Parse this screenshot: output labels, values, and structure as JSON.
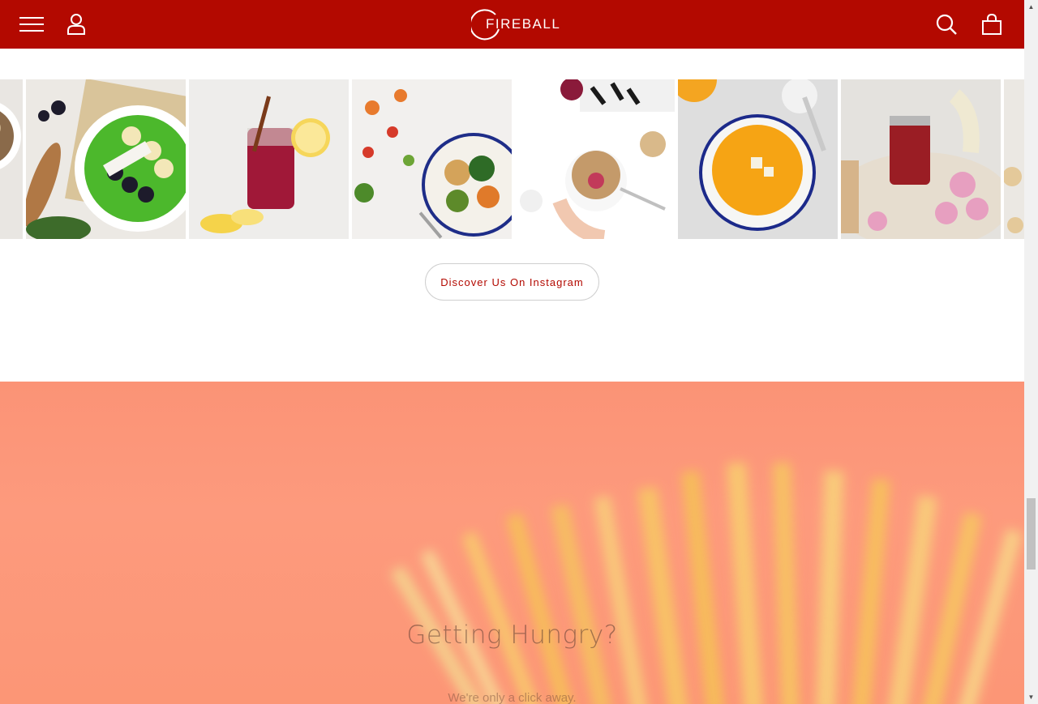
{
  "header": {
    "brand": "FIREBALL",
    "background_color": "#b30900",
    "icons": {
      "menu": "hamburger-menu-icon",
      "account": "user-icon",
      "search": "search-icon",
      "cart": "shopping-bag-icon"
    }
  },
  "instagram": {
    "tiles": [
      {
        "name": "granola-bowl-partial"
      },
      {
        "name": "green-smoothie-bowl"
      },
      {
        "name": "berry-drink-jar"
      },
      {
        "name": "vegetable-grain-bowl"
      },
      {
        "name": "yogurt-granola-bowl"
      },
      {
        "name": "pumpkin-soup"
      },
      {
        "name": "berry-jam-jar"
      },
      {
        "name": "partial-tile"
      }
    ],
    "cta_label": "Discover Us On Instagram"
  },
  "hero": {
    "title": "Getting Hungry?",
    "subtitle": "We're only a click away."
  },
  "colors": {
    "accent": "#b30900",
    "hero_bg": "#fc9676"
  }
}
